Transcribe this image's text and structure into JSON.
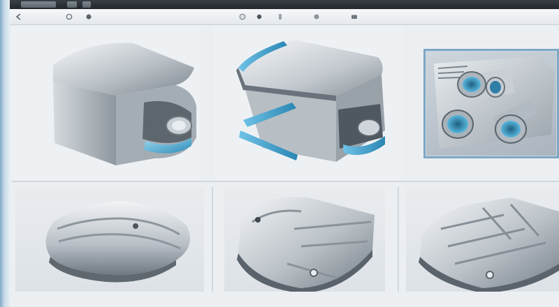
{
  "window": {
    "title": "",
    "accent": "#7ea7c4",
    "titlebar_color": "#2b3035"
  },
  "toolbar": {
    "buttons": [
      {
        "icon": "arrow-left-icon"
      },
      {
        "icon": "refresh-icon"
      },
      {
        "icon": "record-icon"
      },
      {
        "icon": "settings-icon"
      },
      {
        "icon": "record-icon"
      },
      {
        "icon": "pin-icon"
      },
      {
        "icon": "view-icon"
      },
      {
        "icon": "camera-icon"
      }
    ]
  },
  "gallery": {
    "items": [
      {
        "icon": "metal-cube-tube-icon"
      },
      {
        "icon": "clamp-bracket-icon"
      },
      {
        "icon": "tube-pipes-icon",
        "selected": true
      },
      {
        "icon": "rounded-metal-block-icon"
      },
      {
        "icon": "shield-metal-piece-icon"
      },
      {
        "icon": "faceted-metal-plate-icon"
      }
    ]
  }
}
